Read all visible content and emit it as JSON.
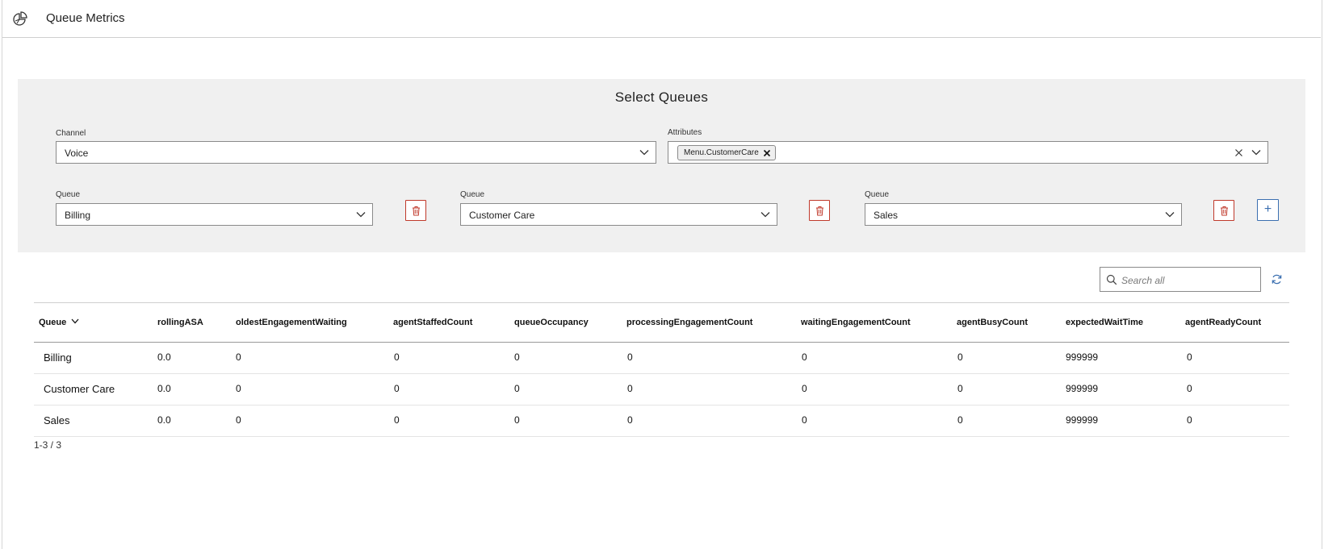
{
  "header": {
    "title": "Queue Metrics",
    "icon": "pie-chart-icon"
  },
  "panel": {
    "title": "Select Queues",
    "channel": {
      "label": "Channel",
      "value": "Voice"
    },
    "attributes": {
      "label": "Attributes",
      "chips": [
        "Menu.CustomerCare"
      ]
    },
    "queues": [
      {
        "label": "Queue",
        "value": "Billing"
      },
      {
        "label": "Queue",
        "value": "Customer Care"
      },
      {
        "label": "Queue",
        "value": "Sales"
      }
    ],
    "add_label": "+"
  },
  "search": {
    "placeholder": "Search all",
    "value": ""
  },
  "table": {
    "columns": [
      "Queue",
      "rollingASA",
      "oldestEngagementWaiting",
      "agentStaffedCount",
      "queueOccupancy",
      "processingEngagementCount",
      "waitingEngagementCount",
      "agentBusyCount",
      "expectedWaitTime",
      "agentReadyCount"
    ],
    "rows": [
      [
        "Billing",
        "0.0",
        "0",
        "0",
        "0",
        "0",
        "0",
        "0",
        "999999",
        "0"
      ],
      [
        "Customer Care",
        "0.0",
        "0",
        "0",
        "0",
        "0",
        "0",
        "0",
        "999999",
        "0"
      ],
      [
        "Sales",
        "0.0",
        "0",
        "0",
        "0",
        "0",
        "0",
        "0",
        "999999",
        "0"
      ]
    ],
    "sort_column": "Queue"
  },
  "pagination": {
    "text": "1-3 / 3"
  },
  "colors": {
    "danger": "#c0392b",
    "accent": "#3b6fb0",
    "panel_bg": "#f0f0f0"
  }
}
